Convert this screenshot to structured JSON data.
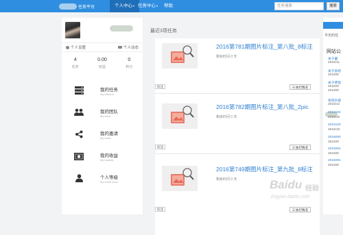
{
  "topbar": {
    "brand_text": "任务平台",
    "nav": [
      {
        "label": "个人中心",
        "active": true,
        "caret": "▾"
      },
      {
        "label": "任务中心",
        "active": false,
        "caret": "▾"
      },
      {
        "label": "帮助",
        "active": false,
        "caret": ""
      }
    ],
    "search_placeholder": "任务搜索",
    "search_button": "搜索"
  },
  "profile": {
    "links": {
      "settings": "个人设置",
      "activity": "个人动态"
    },
    "stats": [
      {
        "value": "4",
        "label": "任务"
      },
      {
        "value": "0.00",
        "label": "收益"
      },
      {
        "value": "0",
        "label": "积分"
      }
    ],
    "menu": [
      {
        "title": "我的任务",
        "subtitle": "My Mission",
        "icon": "server-icon"
      },
      {
        "title": "我的团队",
        "subtitle": "My team",
        "icon": "team-icon"
      },
      {
        "title": "我的邀请",
        "subtitle": "My invite",
        "icon": "share-icon"
      },
      {
        "title": "我的收益",
        "subtitle": "My realistic",
        "icon": "money-icon"
      },
      {
        "title": "个人等级",
        "subtitle": "My credit level",
        "icon": "user-icon"
      }
    ]
  },
  "main": {
    "title": "最近3项任务",
    "tasks": [
      {
        "title": "2016第781期图片标注_第八批_8标注",
        "remain": "剩余时间 0 天",
        "tag": "标注",
        "button": "执行情况"
      },
      {
        "title": "2016第782期图片标注_第八批_2pic",
        "remain": "剩余时间 0 天",
        "tag": "标注",
        "button": "执行情况"
      },
      {
        "title": "2016第749期图片标注_第九批_8标注",
        "remain": "剩余时间 0 天",
        "tag": "标注",
        "button": "执行情况"
      }
    ]
  },
  "rightpanel": {
    "sub": "今天的任",
    "notice_title": "网站公",
    "items": [
      {
        "text": "关于暑",
        "kind": "link"
      },
      {
        "text": "2016/11",
        "kind": "date"
      },
      {
        "text": "关于系统",
        "kind": "link"
      },
      {
        "text": "2016/9/",
        "kind": "date"
      },
      {
        "text": "关于师徒",
        "kind": "link"
      },
      {
        "text": "2016/9/",
        "kind": "date"
      },
      {
        "text": "2016/9/",
        "kind": "date"
      },
      {
        "text": "系统升级",
        "kind": "link"
      },
      {
        "text": "2015/12",
        "kind": "date"
      },
      {
        "text": "2015102",
        "kind": "link"
      },
      {
        "text": "2015/10",
        "kind": "date"
      },
      {
        "text": "2015100",
        "kind": "link"
      },
      {
        "text": "2015/10",
        "kind": "date"
      },
      {
        "text": "2015090",
        "kind": "link"
      },
      {
        "text": "2015/9/",
        "kind": "date"
      },
      {
        "text": "2015091",
        "kind": "link"
      },
      {
        "text": "2015/9/",
        "kind": "date"
      },
      {
        "text": "2015091",
        "kind": "link"
      },
      {
        "text": "2015/9/",
        "kind": "date"
      }
    ]
  },
  "watermark": {
    "logo": "Baidu",
    "brand": "经验",
    "url": "jingyan.baidu.com"
  },
  "colors": {
    "topbar": "#2f8ee0",
    "nav_active": "#1f6fb8",
    "link": "#2f7fd0",
    "page_bg": "#f2f3f5"
  }
}
